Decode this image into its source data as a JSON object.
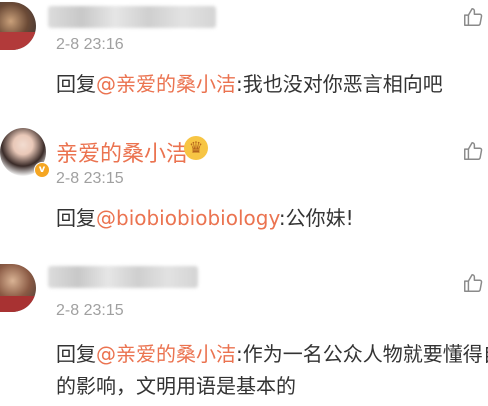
{
  "comments": [
    {
      "timestamp": "2-8 23:16",
      "reply_prefix": "回复",
      "mention": "@亲爱的桑小洁",
      "text": ":我也没对你恶言相向吧"
    },
    {
      "username": "亲爱的桑小洁",
      "badge_icon": "crown-icon",
      "vip_badge": "v",
      "timestamp": "2-8 23:15",
      "reply_prefix": "回复",
      "mention": "@biobiobiobiology",
      "text": ":公你妹!"
    },
    {
      "timestamp": "2-8 23:15",
      "reply_prefix": "回复",
      "mention": "@亲爱的桑小洁",
      "text": ":作为一名公众人物就要懂得自己的影响，文明用语是基本的"
    }
  ],
  "colors": {
    "mention": "#eb7350",
    "timestamp": "#a0a0a0",
    "text": "#333333"
  },
  "icons": {
    "like": "thumbs-up-icon"
  }
}
